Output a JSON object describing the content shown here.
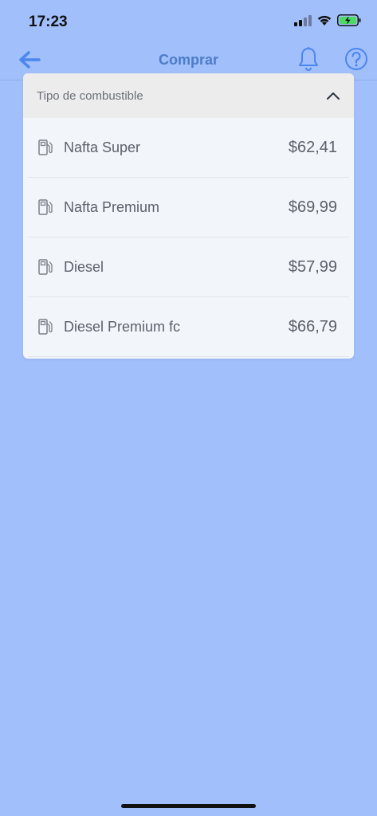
{
  "status_bar": {
    "time": "17:23",
    "icons": [
      "cellular-signal-icon",
      "wifi-icon",
      "battery-charging-icon"
    ]
  },
  "nav": {
    "title": "Comprar",
    "back_icon": "arrow-left-icon",
    "bell_icon": "bell-icon",
    "help_icon": "help-icon"
  },
  "dropdown": {
    "label": "Tipo de combustible",
    "chevron_icon": "chevron-up-icon",
    "items": [
      {
        "name": "Nafta Super",
        "price": "$62,41",
        "icon": "fuel-pump-icon"
      },
      {
        "name": "Nafta Premium",
        "price": "$69,99",
        "icon": "fuel-pump-icon"
      },
      {
        "name": "Diesel",
        "price": "$57,99",
        "icon": "fuel-pump-icon"
      },
      {
        "name": "Diesel Premium fc",
        "price": "$66,79",
        "icon": "fuel-pump-icon"
      }
    ]
  },
  "colors": {
    "background": "#a1bffb",
    "accent": "#4d7bc9",
    "dropdown_background": "#f2f5f9",
    "header_background": "#ececec",
    "text": "#5c606a",
    "battery": "#4cd964"
  }
}
